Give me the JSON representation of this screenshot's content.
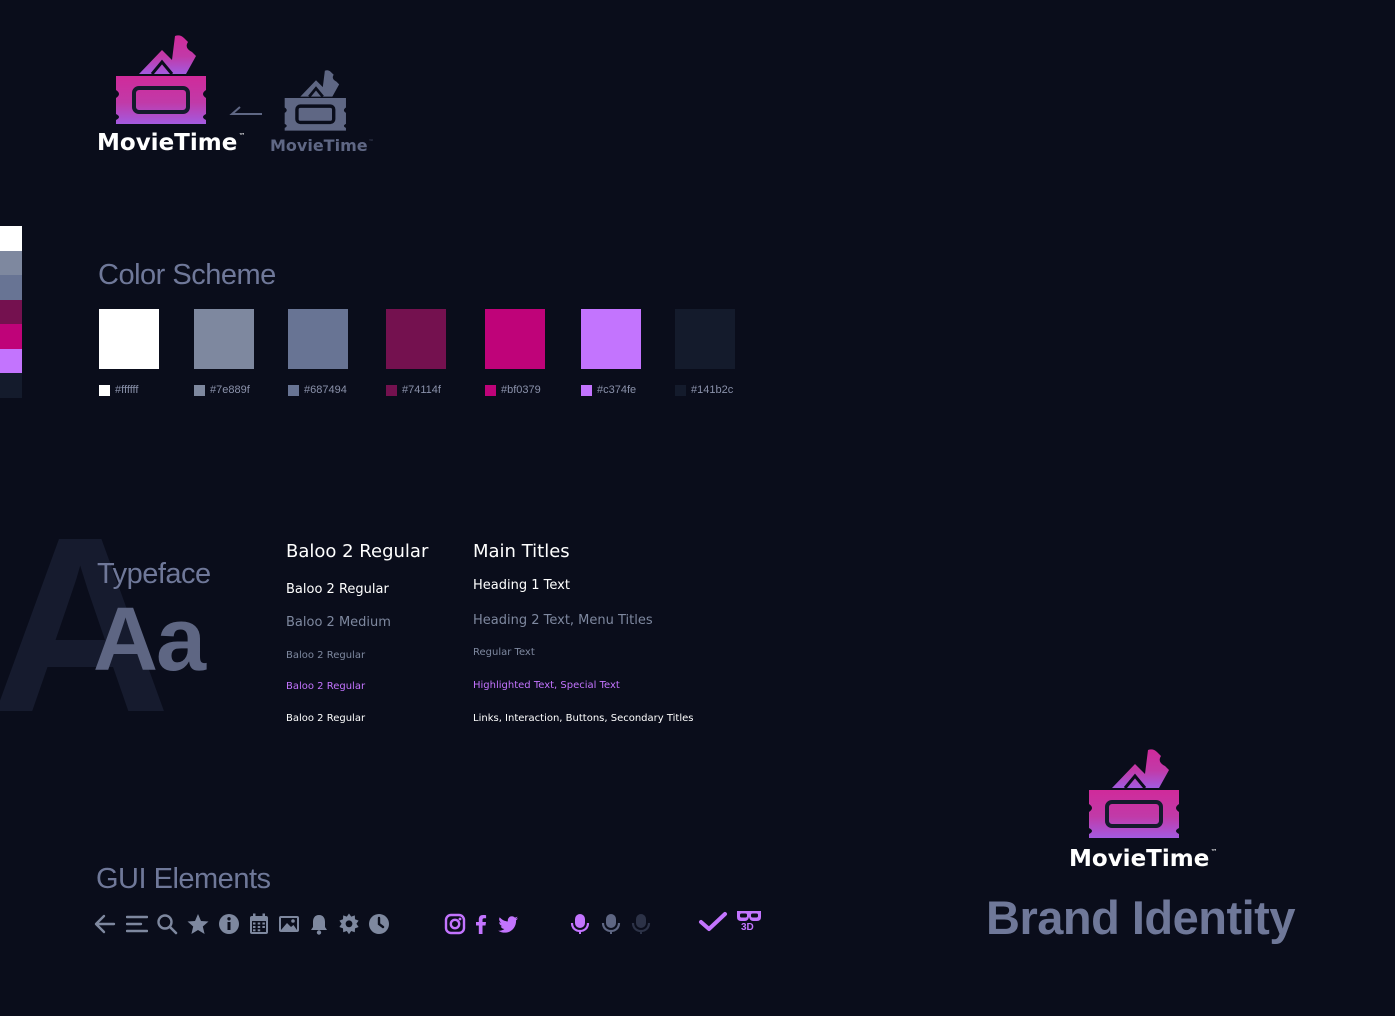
{
  "logos": {
    "primary": {
      "name": "MovieTime",
      "tm": "™"
    },
    "secondary": {
      "name": "MovieTime",
      "tm": "™"
    },
    "footer": {
      "name": "MovieTime",
      "tm": "™"
    }
  },
  "color_scheme": {
    "title": "Color Scheme",
    "swatches": [
      {
        "hex": "#ffffff",
        "label": "#ffffff"
      },
      {
        "hex": "#7e889f",
        "label": "#7e889f"
      },
      {
        "hex": "#687494",
        "label": "#687494"
      },
      {
        "hex": "#74114f",
        "label": "#74114f"
      },
      {
        "hex": "#bf0379",
        "label": "#bf0379"
      },
      {
        "hex": "#c374fe",
        "label": "#c374fe"
      },
      {
        "hex": "#141b2c",
        "label": "#141b2c"
      }
    ]
  },
  "typeface": {
    "title": "Typeface",
    "sample": "Aa",
    "big_letter": "A",
    "fonts": [
      {
        "label": "Baloo 2 Regular",
        "color": "#ffffff"
      },
      {
        "label": "Baloo 2 Regular",
        "color": "#ffffff"
      },
      {
        "label": "Baloo 2 Medium",
        "color": "#7e889f"
      },
      {
        "label": "Baloo 2 Regular",
        "color": "#7e889f"
      },
      {
        "label": "Baloo 2 Regular",
        "color": "#c374fe"
      },
      {
        "label": "Baloo 2 Regular",
        "color": "#ffffff"
      }
    ],
    "usages": [
      {
        "label": "Main Titles",
        "color": "#ffffff"
      },
      {
        "label": "Heading 1 Text",
        "color": "#ffffff"
      },
      {
        "label": "Heading 2 Text, Menu Titles",
        "color": "#7e889f"
      },
      {
        "label": "Regular Text",
        "color": "#7e889f"
      },
      {
        "label": "Highlighted Text, Special Text",
        "color": "#c374fe"
      },
      {
        "label": "Links, Interaction, Buttons, Secondary Titles",
        "color": "#ffffff"
      }
    ]
  },
  "gui_elements": {
    "title": "GUI Elements",
    "icons": [
      "back-arrow-icon",
      "menu-icon",
      "search-icon",
      "star-icon",
      "info-icon",
      "calendar-icon",
      "image-icon",
      "bell-icon",
      "settings-icon",
      "clock-icon",
      "instagram-icon",
      "facebook-icon",
      "twitter-icon",
      "microphone-icon",
      "microphone-icon",
      "microphone-icon",
      "check-icon",
      "3d-glasses-icon"
    ],
    "glasses_label": "3D"
  },
  "brand": {
    "title": "Brand Identity"
  },
  "colors": {
    "accent": "#c374fe",
    "muted": "#5e6683",
    "background": "#0a0d1b"
  }
}
